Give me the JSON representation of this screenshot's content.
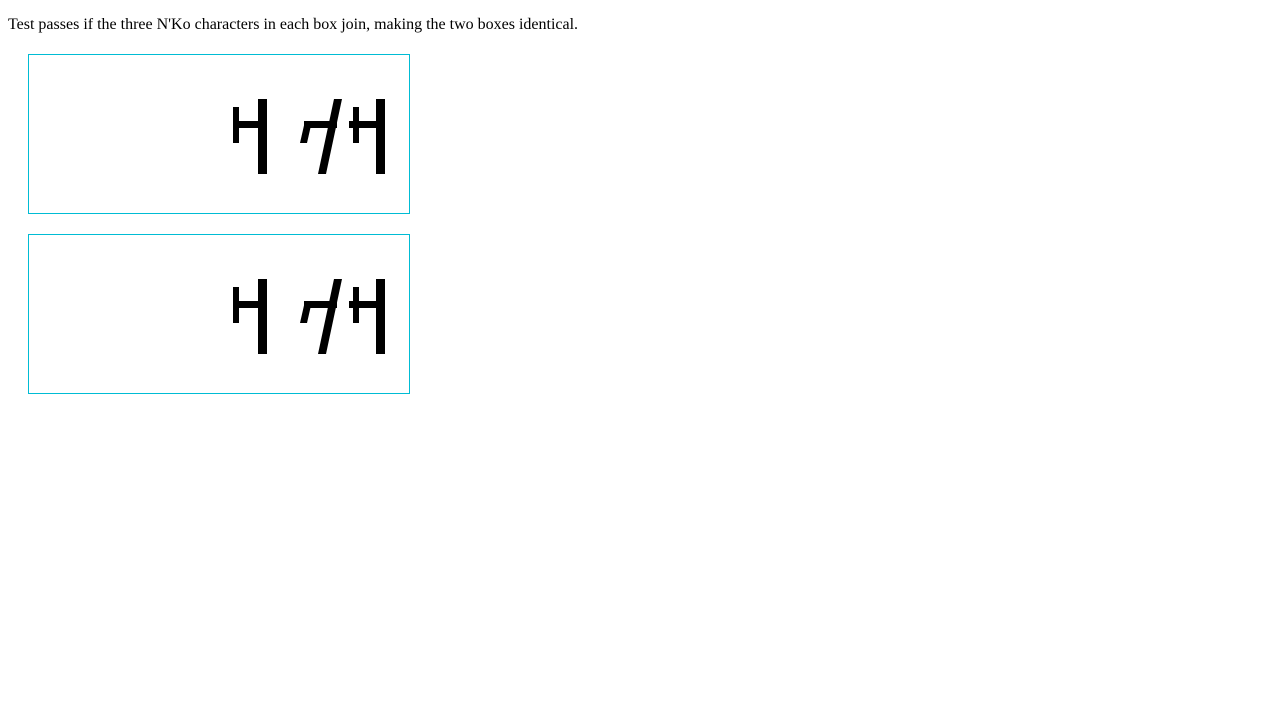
{
  "instructions": "Test passes if the three N'Ko characters in each box join, making the two boxes identical.",
  "boxes": [
    {
      "name": "reference-box"
    },
    {
      "name": "test-box"
    }
  ],
  "colors": {
    "box_border": "#00bcd4",
    "glyph": "#000000",
    "background": "#ffffff"
  }
}
